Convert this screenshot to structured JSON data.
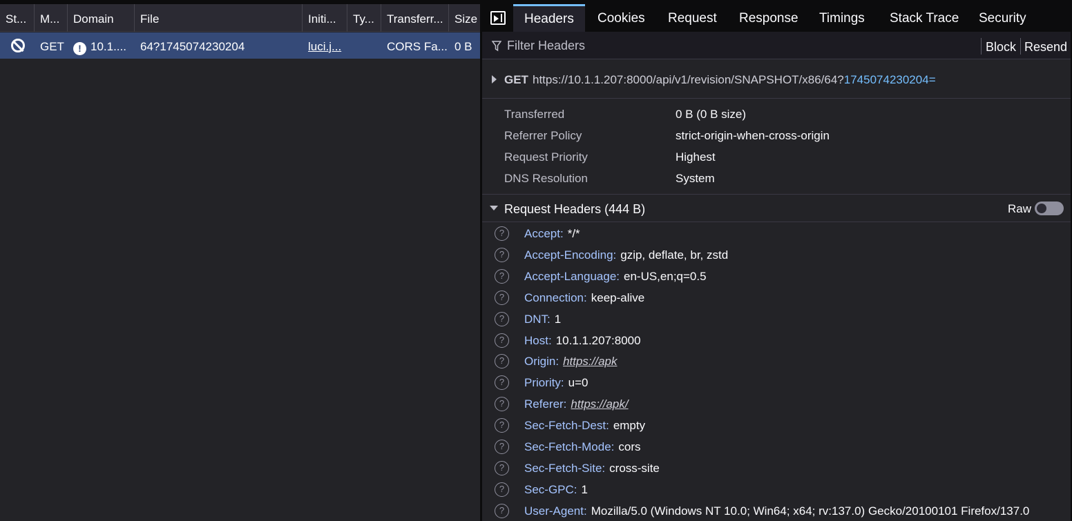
{
  "request_table": {
    "columns": [
      "St...",
      "M...",
      "Domain",
      "File",
      "Initi...",
      "Ty...",
      "Transferr...",
      "Size"
    ],
    "row": {
      "method": "GET",
      "domain": "10.1....",
      "file": "64?1745074230204",
      "initiator": "luci.j...",
      "type": "",
      "transferred": "CORS Fa...",
      "size": "0 B"
    }
  },
  "tabs": [
    "Headers",
    "Cookies",
    "Request",
    "Response",
    "Timings",
    "Stack Trace",
    "Security"
  ],
  "filter": {
    "placeholder": "Filter Headers",
    "block_label": "Block",
    "resend_label": "Resend"
  },
  "request_line": {
    "method": "GET",
    "url_base": "https://10.1.1.207:8000/api/v1/revision/SNAPSHOT/x86/64?",
    "url_query": "1745074230204",
    "url_suffix": "="
  },
  "summary": [
    {
      "label": "Transferred",
      "value": "0 B (0 B size)"
    },
    {
      "label": "Referrer Policy",
      "value": "strict-origin-when-cross-origin"
    },
    {
      "label": "Request Priority",
      "value": "Highest"
    },
    {
      "label": "DNS Resolution",
      "value": "System"
    }
  ],
  "request_headers": {
    "title": "Request Headers (444 B)",
    "raw_label": "Raw",
    "items": [
      {
        "name": "Accept:",
        "value": "*/*"
      },
      {
        "name": "Accept-Encoding:",
        "value": "gzip, deflate, br, zstd"
      },
      {
        "name": "Accept-Language:",
        "value": "en-US,en;q=0.5"
      },
      {
        "name": "Connection:",
        "value": "keep-alive"
      },
      {
        "name": "DNT:",
        "value": "1"
      },
      {
        "name": "Host:",
        "value": "10.1.1.207:8000"
      },
      {
        "name": "Origin:",
        "value": "https://apk"
      },
      {
        "name": "Priority:",
        "value": "u=0"
      },
      {
        "name": "Referer:",
        "value": "https://apk/"
      },
      {
        "name": "Sec-Fetch-Dest:",
        "value": "empty"
      },
      {
        "name": "Sec-Fetch-Mode:",
        "value": "cors"
      },
      {
        "name": "Sec-Fetch-Site:",
        "value": "cross-site"
      },
      {
        "name": "Sec-GPC:",
        "value": "1"
      },
      {
        "name": "User-Agent:",
        "value": "Mozilla/5.0 (Windows NT 10.0; Win64; x64; rv:137.0) Gecko/20100101 Firefox/137.0"
      }
    ]
  },
  "colors": {
    "accent": "#75bfff",
    "selected_row": "#354a78",
    "header_name": "#a5c4ff"
  }
}
